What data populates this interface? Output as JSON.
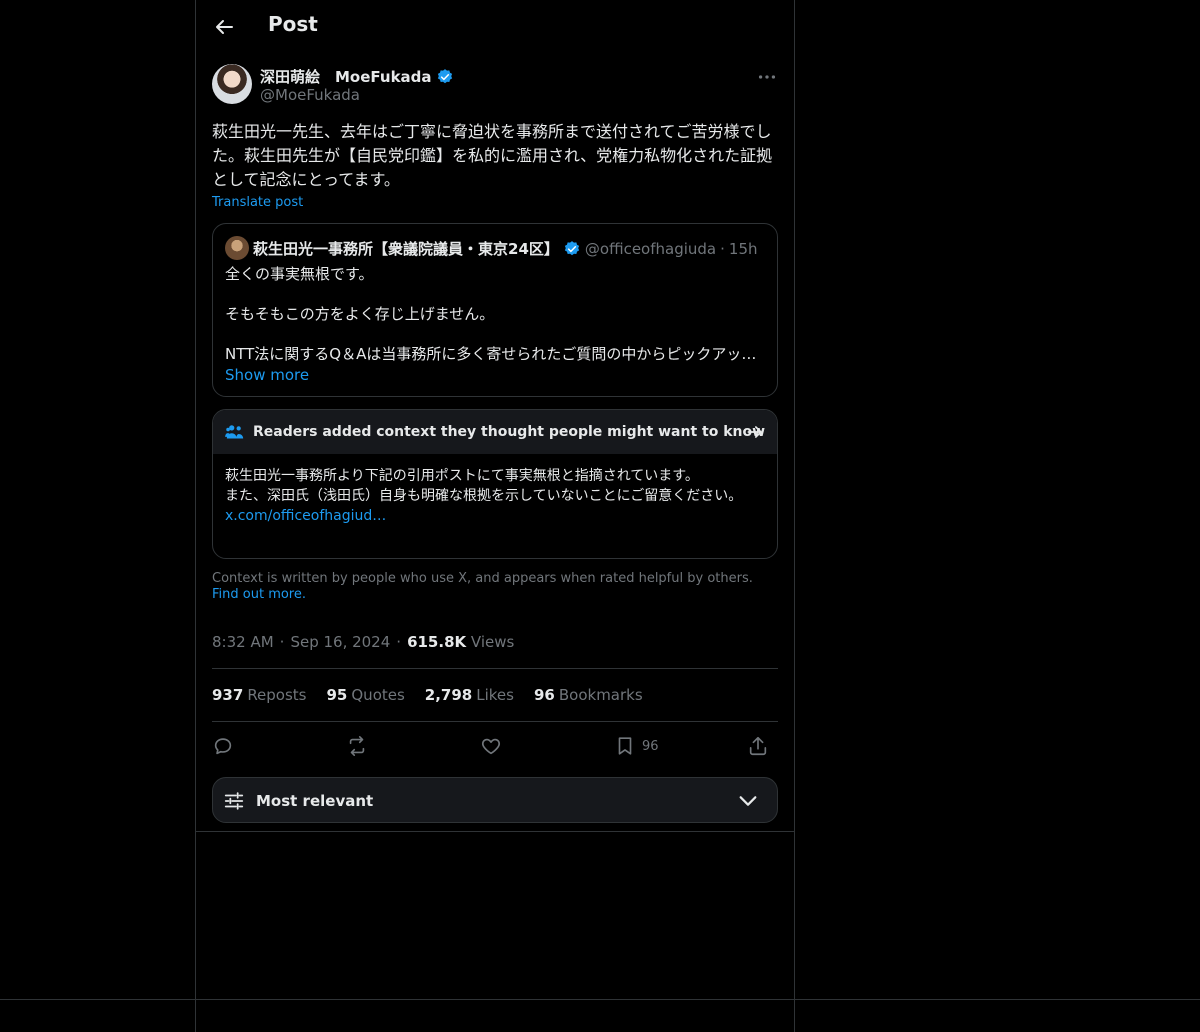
{
  "header": {
    "title": "Post"
  },
  "author": {
    "name": "深田萌絵　MoeFukada",
    "handle": "@MoeFukada"
  },
  "post": {
    "text": "萩生田光一先生、去年はご丁寧に脅迫状を事務所まで送付されてご苦労様でした。萩生田先生が【自民党印鑑】を私的に濫用され、党権力私物化された証拠として記念にとってます。",
    "translate_label": "Translate post"
  },
  "quote": {
    "name": "萩生田光一事務所【衆議院議員・東京24区】",
    "handle": "@officeofhagiuda",
    "time": "15h",
    "line1": "全くの事実無根です。",
    "line2": "そもそもこの方をよく存じ上げません。",
    "line3": "NTT法に関するQ＆Aは当事務所に多く寄せられたご質問の中からピックアップ…",
    "show_more": "Show more"
  },
  "note": {
    "title": "Readers added context they thought people might want to know",
    "body1": "萩生田光一事務所より下記の引用ポストにて事実無根と指摘されています。",
    "body2": "また、深田氏（浅田氏）自身も明確な根拠を示していないことにご留意ください。",
    "link": "x.com/officeofhagiud…"
  },
  "context": {
    "text": "Context is written by people who use X, and appears when rated helpful by others. ",
    "link": "Find out more."
  },
  "meta": {
    "time": "8:32 AM",
    "date": "Sep 16, 2024",
    "views_count": "615.8K",
    "views_label": "Views"
  },
  "stats": {
    "reposts_count": "937",
    "reposts_label": "Reposts",
    "quotes_count": "95",
    "quotes_label": "Quotes",
    "likes_count": "2,798",
    "likes_label": "Likes",
    "bookmarks_count": "96",
    "bookmarks_label": "Bookmarks"
  },
  "actions": {
    "bookmark_count": "96"
  },
  "sort": {
    "label": "Most relevant"
  },
  "colors": {
    "accent": "#1d9bf0",
    "background": "#000000",
    "border": "#2f3336",
    "muted": "#71767b"
  },
  "icons": [
    "back-arrow-icon",
    "verified-badge-icon",
    "more-icon",
    "people-icon",
    "arrow-right-icon",
    "reply-icon",
    "repost-icon",
    "like-icon",
    "bookmark-icon",
    "share-icon",
    "sliders-icon",
    "chevron-down-icon"
  ]
}
